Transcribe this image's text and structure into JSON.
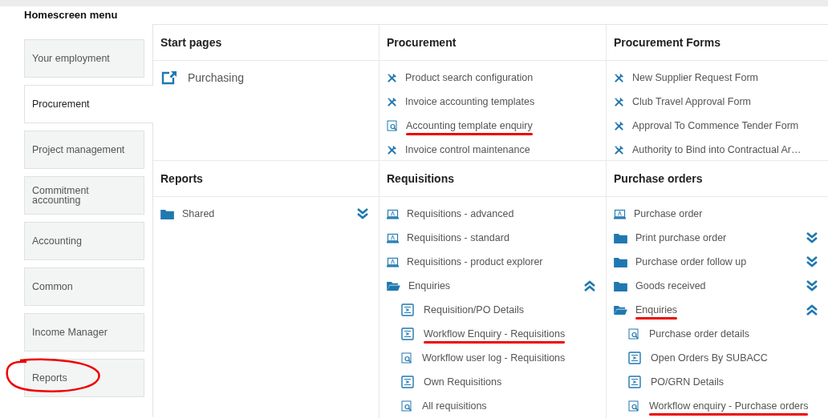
{
  "title": "Homescreen menu",
  "sidebar": {
    "items": [
      {
        "label": "Your employment",
        "selected": false,
        "annotated": false
      },
      {
        "label": "Procurement",
        "selected": true,
        "annotated": false
      },
      {
        "label": "Project management",
        "selected": false,
        "annotated": false
      },
      {
        "label": "Commitment accounting",
        "selected": false,
        "annotated": false
      },
      {
        "label": "Accounting",
        "selected": false,
        "annotated": false
      },
      {
        "label": "Common",
        "selected": false,
        "annotated": false
      },
      {
        "label": "Income Manager",
        "selected": false,
        "annotated": false
      },
      {
        "label": "Reports",
        "selected": false,
        "annotated": true
      }
    ]
  },
  "sections": [
    {
      "title": "Start pages",
      "items": [
        {
          "kind": "external",
          "label": "Purchasing",
          "annotated": false
        }
      ]
    },
    {
      "title": "Procurement",
      "items": [
        {
          "kind": "tool",
          "label": "Product search configuration",
          "annotated": false
        },
        {
          "kind": "tool",
          "label": "Invoice accounting templates",
          "annotated": false
        },
        {
          "kind": "enquiry",
          "label": "Accounting template enquiry",
          "annotated": true
        },
        {
          "kind": "tool",
          "label": "Invoice control maintenance",
          "annotated": false
        }
      ]
    },
    {
      "title": "Procurement Forms",
      "items": [
        {
          "kind": "tool",
          "label": "New Supplier Request Form",
          "annotated": false
        },
        {
          "kind": "tool",
          "label": "Club Travel Approval Form",
          "annotated": false
        },
        {
          "kind": "tool",
          "label": "Approval To Commence Tender Form",
          "annotated": false
        },
        {
          "kind": "tool",
          "label": "Authority to Bind into Contractual Ar…",
          "annotated": false
        }
      ]
    },
    {
      "title": "Reports",
      "items": [
        {
          "kind": "folder",
          "label": "Shared",
          "expanded": false,
          "annotated": false
        }
      ]
    },
    {
      "title": "Requisitions",
      "items": [
        {
          "kind": "form",
          "label": "Requisitions - advanced",
          "annotated": false
        },
        {
          "kind": "form",
          "label": "Requisitions - standard",
          "annotated": false
        },
        {
          "kind": "form",
          "label": "Requisitions - product explorer",
          "annotated": false
        },
        {
          "kind": "folder",
          "label": "Enquiries",
          "expanded": true,
          "annotated": false,
          "children": [
            {
              "kind": "summary",
              "label": "Requisition/PO Details",
              "annotated": false
            },
            {
              "kind": "summary",
              "label": "Workflow Enquiry - Requisitions",
              "annotated": true
            },
            {
              "kind": "enquiry",
              "label": "Workflow user log - Requisitions",
              "annotated": false
            },
            {
              "kind": "summary",
              "label": "Own Requisitions",
              "annotated": false
            },
            {
              "kind": "enquiry",
              "label": "All requisitions",
              "annotated": false
            }
          ]
        }
      ]
    },
    {
      "title": "Purchase orders",
      "items": [
        {
          "kind": "form",
          "label": "Purchase order",
          "annotated": false
        },
        {
          "kind": "folder",
          "label": "Print purchase order",
          "expanded": false,
          "annotated": false
        },
        {
          "kind": "folder",
          "label": "Purchase order follow up",
          "expanded": false,
          "annotated": false
        },
        {
          "kind": "folder",
          "label": "Goods received",
          "expanded": false,
          "annotated": false
        },
        {
          "kind": "folder",
          "label": "Enquiries",
          "expanded": true,
          "annotated": true,
          "children": [
            {
              "kind": "enquiry",
              "label": "Purchase order details",
              "annotated": false
            },
            {
              "kind": "summary",
              "label": "Open Orders By SUBACC",
              "annotated": false
            },
            {
              "kind": "summary",
              "label": "PO/GRN Details",
              "annotated": false
            },
            {
              "kind": "enquiry",
              "label": "Workflow enquiry - Purchase orders",
              "annotated": true
            }
          ]
        }
      ]
    }
  ]
}
